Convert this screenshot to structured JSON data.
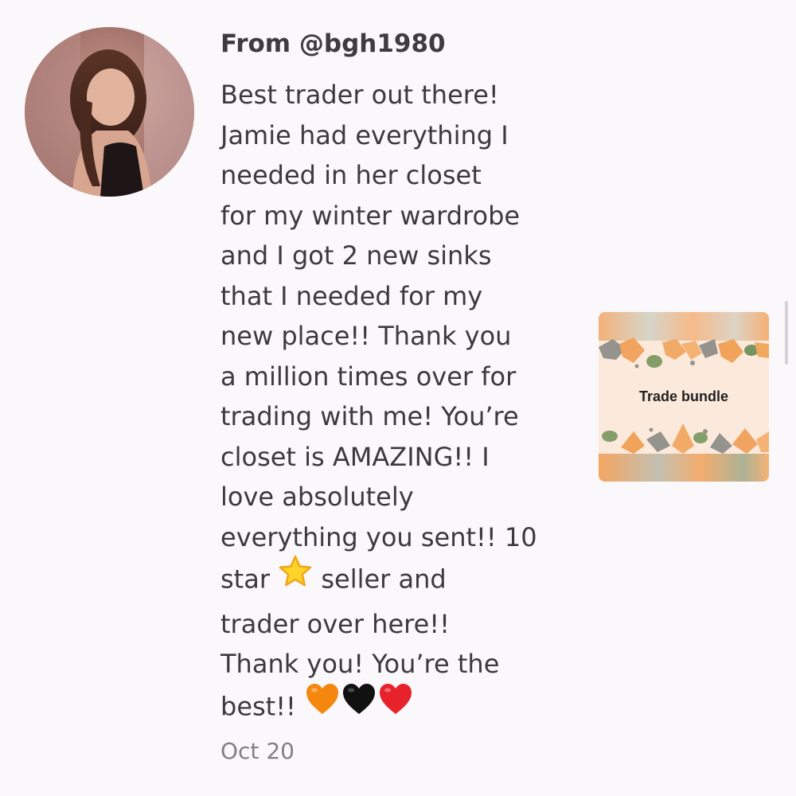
{
  "review": {
    "from_label": "From @bgh1980",
    "lines": [
      "Best trader out there!",
      "Jamie had everything I",
      "needed in her closet",
      "for my winter wardrobe",
      "and I got 2 new sinks",
      "that I needed for my",
      "new place!! Thank you",
      "a million times over for",
      "trading with me! You’re",
      "closet is AMAZING!! I",
      "love absolutely",
      "everything you sent!! 10"
    ],
    "line_star_before": "star",
    "line_star_after": "seller and",
    "lines_tail": [
      "trader over here!!",
      "Thank you! You’re the"
    ],
    "last_line": "best!!",
    "date": "Oct 20"
  },
  "listing": {
    "label": "Trade bundle"
  },
  "icons": {
    "star": "star-emoji",
    "hearts": [
      "orange-heart-emoji",
      "black-heart-emoji",
      "red-heart-emoji"
    ]
  },
  "colors": {
    "background": "#fbf8fb",
    "text": "#3b3b3b",
    "date": "#808080",
    "orange_heart": "#f5870f",
    "black_heart": "#111111",
    "red_heart": "#e8222a",
    "star": "#ffd42a"
  }
}
